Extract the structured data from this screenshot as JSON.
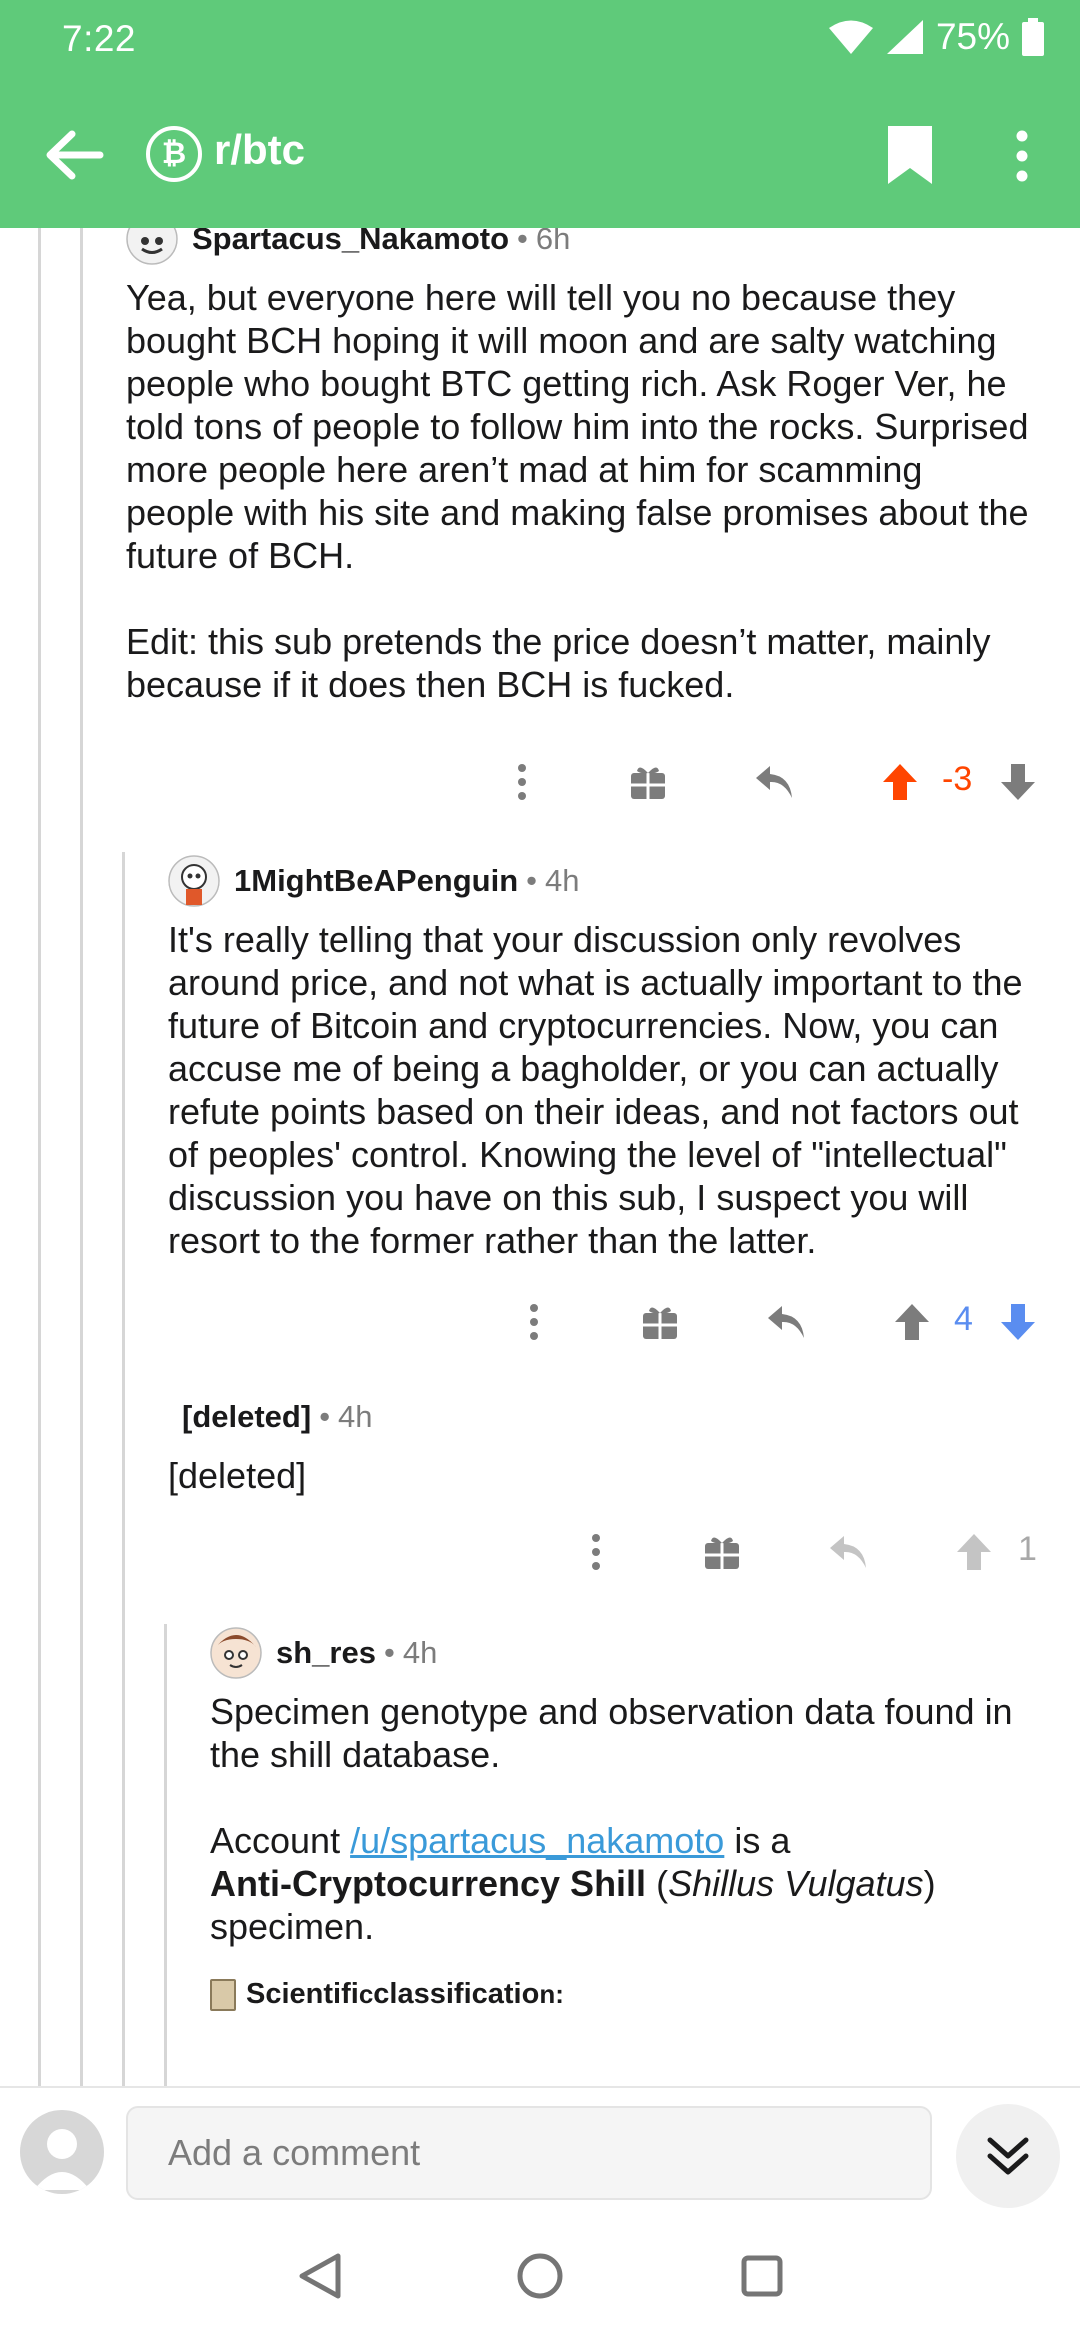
{
  "status_bar": {
    "time": "7:22",
    "battery": "75%"
  },
  "header": {
    "subreddit": "r/btc",
    "sub_icon_glyph": "₿"
  },
  "comments": [
    {
      "author": "Spartacus_Nakamoto",
      "age": "6h",
      "paragraphs": [
        "Yea, but everyone here will tell you no because they bought BCH hoping it will moon and are salty watching people who bought BTC getting rich. Ask Roger Ver, he told tons of people to follow him into the rocks. Surprised more people here aren’t mad at him for scamming people with his site and making false promises about the future of BCH.",
        "Edit: this sub pretends the price doesn’t matter, mainly because if it does then BCH is fucked."
      ],
      "score": "-3",
      "vote_state": "up"
    },
    {
      "author": "1MightBeAPenguin",
      "age": "4h",
      "paragraphs": [
        "It's really telling that your discussion only revolves around price, and not what is actually important to the future of Bitcoin and cryptocurrencies. Now, you can accuse me of being a bagholder, or you can actually refute points based on their ideas, and not factors out of peoples' control. Knowing the level of \"intellectual\" discussion you have on this sub, I suspect you will resort to the former rather than the latter."
      ],
      "score": "4",
      "vote_state": "down"
    },
    {
      "author": "[deleted]",
      "age": "4h",
      "paragraphs": [
        "[deleted]"
      ],
      "score": "1",
      "vote_state": "none"
    },
    {
      "author": "sh_res",
      "age": "4h",
      "p1": "Specimen genotype and observation data found in the shill database.",
      "p2_prefix": "Account ",
      "p2_link": "/u/spartacus_nakamoto",
      "p2_mid": " is a ",
      "p2_bold": "Anti-Cryptocurrency Shill",
      "p2_open": " (",
      "p2_italic": "Shillus Vulgatus",
      "p2_close": ")",
      "p2_end": "specimen.",
      "sci_a": "Scientifi",
      "sci_b": "c",
      "sci_c": " classificatio",
      "sci_d": "n",
      "sci_e": ":"
    }
  ],
  "composer": {
    "placeholder": "Add a comment"
  },
  "colors": {
    "header_green": "#5fca7a",
    "upvote_orange": "#ff4500",
    "downvote_blue": "#5a8df0",
    "link_blue": "#3a9ad9",
    "icon_gray": "#7c7c7c"
  }
}
